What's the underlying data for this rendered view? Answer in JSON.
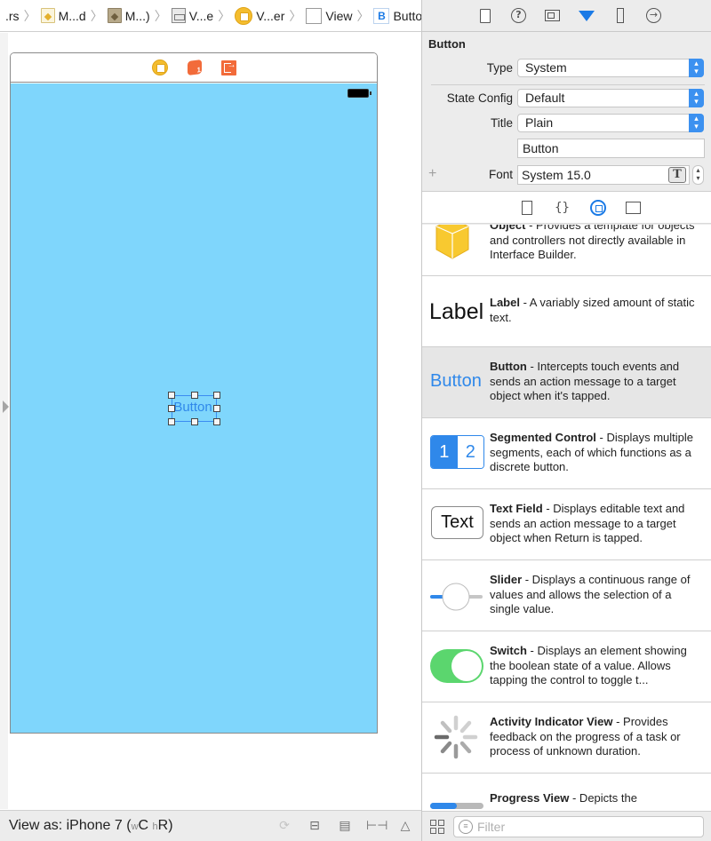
{
  "breadcrumb": {
    "items": [
      {
        "label": ".rs",
        "icon": "none"
      },
      {
        "label": "M...d",
        "icon": "storyboard-file-icon"
      },
      {
        "label": "M...)",
        "icon": "storyboard-base-file-icon"
      },
      {
        "label": "V...e",
        "icon": "scene-icon"
      },
      {
        "label": "V...er",
        "icon": "view-controller-icon"
      },
      {
        "label": "View",
        "icon": "view-icon"
      },
      {
        "label": "Button",
        "icon": "button-icon",
        "glyph": "B"
      }
    ],
    "separator": "〉"
  },
  "canvas": {
    "button_title": "Button",
    "view_background": "#7fd6fc",
    "dock_icons": [
      "view-controller-icon",
      "first-responder-icon",
      "exit-icon"
    ]
  },
  "bottom_bar": {
    "view_as_prefix": "View as: iPhone 7 (",
    "w_small": "w",
    "w_value": "C",
    "h_small": "h",
    "h_value": "R",
    "suffix": ")",
    "tools": [
      "update-frames-icon",
      "embed-in-stack-icon",
      "align-icon",
      "pin-icon",
      "resolve-issues-icon"
    ]
  },
  "inspector": {
    "tabs": [
      "file-inspector",
      "quick-help",
      "identity-inspector",
      "attributes-inspector",
      "size-inspector",
      "connections-inspector"
    ],
    "active_tab": "attributes-inspector",
    "section_title": "Button",
    "type_label": "Type",
    "type_value": "System",
    "state_config_label": "State Config",
    "state_config_value": "Default",
    "title_label": "Title",
    "title_value": "Plain",
    "title_text": "Button",
    "font_label": "Font",
    "font_value": "System 15.0",
    "font_button_glyph": "T",
    "plus_glyph": "+"
  },
  "library": {
    "tabs": [
      "file-templates",
      "code-snippets",
      "object-library",
      "media-library"
    ],
    "active_tab": "object-library",
    "items": [
      {
        "name": "Object",
        "desc": " - Provides a template for objects and controllers not directly available in Interface Builder."
      },
      {
        "name": "Label",
        "desc": " - A variably sized amount of static text.",
        "preview": "Label"
      },
      {
        "name": "Button",
        "desc": " - Intercepts touch events and sends an action message to a target object when it's tapped.",
        "preview": "Button"
      },
      {
        "name": "Segmented Control",
        "desc": " - Displays multiple segments, each of which functions as a discrete button.",
        "preview_a": "1",
        "preview_b": "2"
      },
      {
        "name": "Text Field",
        "desc": " - Displays editable text and sends an action message to a target object when Return is tapped.",
        "preview": "Text"
      },
      {
        "name": "Slider",
        "desc": " - Displays a continuous range of values and allows the selection of a single value."
      },
      {
        "name": "Switch",
        "desc": " - Displays an element showing the boolean state of a value. Allows tapping the control to toggle t..."
      },
      {
        "name": "Activity Indicator View",
        "desc": " - Provides feedback on the progress of a task or process of unknown duration."
      },
      {
        "name": "Progress View",
        "desc": " - Depicts the"
      }
    ],
    "selected_index": 2,
    "filter_placeholder": "Filter"
  },
  "colors": {
    "accent": "#1a7ae6",
    "switch_on": "#5bd66e",
    "object_cube": "#f8c930"
  }
}
